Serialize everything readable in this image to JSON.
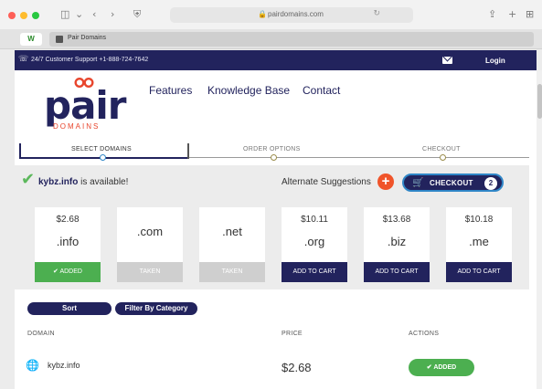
{
  "browser": {
    "url": "pairdomains.com",
    "tab_title": "Pair Domains",
    "favicon_text": "W"
  },
  "topbar": {
    "support_label": "24/7 Customer Support",
    "phone": "+1-888-724-7642",
    "login": "Login"
  },
  "logo": {
    "word": "pair",
    "sub": "DOMAINS"
  },
  "nav": {
    "features": "Features",
    "knowledge_base": "Knowledge Base",
    "contact": "Contact"
  },
  "steps": [
    {
      "label": "SELECT DOMAINS"
    },
    {
      "label": "ORDER OPTIONS"
    },
    {
      "label": "CHECKOUT"
    }
  ],
  "availability": {
    "domain": "kybz.info",
    "suffix": "is available!"
  },
  "alternate": "Alternate Suggestions",
  "checkout": {
    "label": "CHECKOUT",
    "count": "2"
  },
  "cards": [
    {
      "price": "$2.68",
      "tld": ".info",
      "action": "✔ ADDED"
    },
    {
      "price": "",
      "tld": ".com",
      "action": "TAKEN"
    },
    {
      "price": "",
      "tld": ".net",
      "action": "TAKEN"
    },
    {
      "price": "$10.11",
      "tld": ".org",
      "action": "ADD TO CART"
    },
    {
      "price": "$13.68",
      "tld": ".biz",
      "action": "ADD TO CART"
    },
    {
      "price": "$10.18",
      "tld": ".me",
      "action": "ADD TO CART"
    }
  ],
  "filters": {
    "sort": "Sort",
    "filter": "Filter By Category"
  },
  "table": {
    "headers": {
      "domain": "DOMAIN",
      "price": "PRICE",
      "actions": "ACTIONS"
    },
    "rows": [
      {
        "domain": "kybz.info",
        "price": "$2.68",
        "action": "✔ ADDED"
      }
    ]
  },
  "colors": {
    "brand_navy": "#22235d",
    "accent_orange": "#f0542a",
    "success_green": "#4caf50",
    "link_blue": "#2f86c7"
  }
}
